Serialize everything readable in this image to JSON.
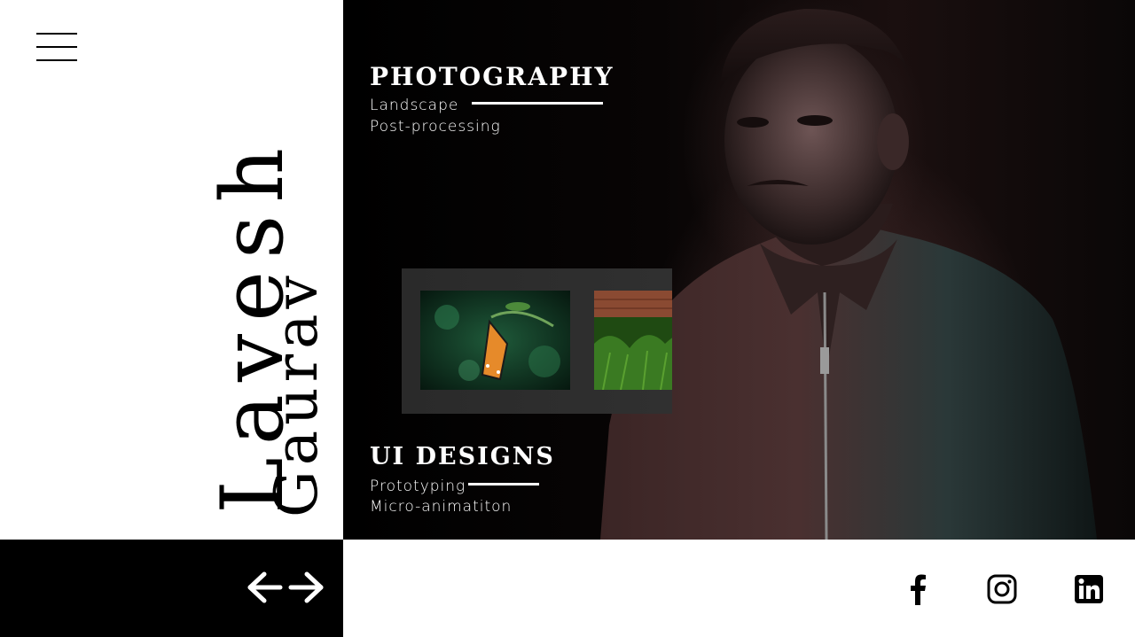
{
  "name": {
    "first": "Lavesh",
    "last": "Gaurav"
  },
  "nav": {
    "menu_icon": "hamburger-menu-icon"
  },
  "photography": {
    "title": "PHOTOGRAPHY",
    "items": [
      "Landscape",
      "Post-processing"
    ]
  },
  "ui_designs": {
    "title": "UI DESIGNS",
    "items": [
      "Prototyping",
      "Micro-animatiton"
    ]
  },
  "gallery": {
    "thumbnails": [
      "butterfly-photo",
      "grass-brick-wall-photo"
    ]
  },
  "footer": {
    "nav_arrows_icon": "left-right-arrows-icon",
    "social": [
      "facebook-icon",
      "instagram-icon",
      "linkedin-icon"
    ]
  },
  "colors": {
    "dark": "#000000",
    "light": "#ffffff",
    "gallery_bg": "#2d2d2d"
  }
}
